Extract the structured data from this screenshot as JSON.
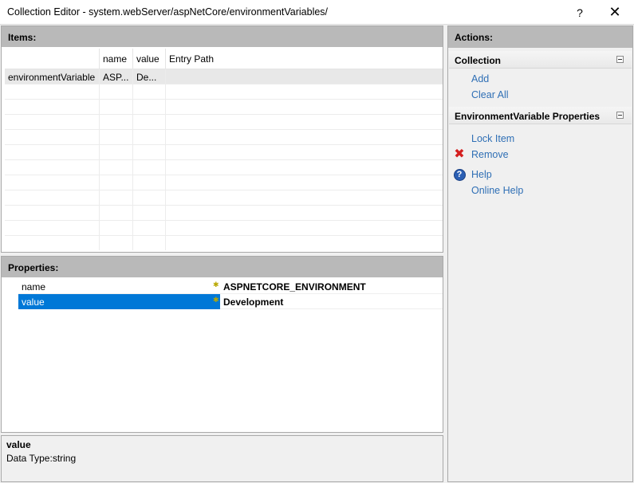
{
  "window": {
    "title": "Collection Editor - system.webServer/aspNetCore/environmentVariables/",
    "help_glyph": "?",
    "close_glyph": "✕"
  },
  "items": {
    "header": "Items:",
    "columns": [
      "",
      "name",
      "value",
      "Entry Path"
    ],
    "rows": [
      [
        "environmentVariable",
        "ASP...",
        "De...",
        ""
      ]
    ]
  },
  "properties": {
    "header": "Properties:",
    "rows": [
      {
        "name": "name",
        "value": "ASPNETCORE_ENVIRONMENT",
        "marker": "✱"
      },
      {
        "name": "value",
        "value": "Development",
        "marker": "✱"
      }
    ]
  },
  "description": {
    "title": "value",
    "text": "Data Type:string"
  },
  "actions": {
    "header": "Actions:",
    "collection": {
      "label": "Collection",
      "links": [
        "Add",
        "Clear All"
      ]
    },
    "item_properties": {
      "label": "EnvironmentVariable Properties",
      "links": [
        {
          "label": "Lock Item",
          "icon": ""
        },
        {
          "label": "Remove",
          "icon": "remove-icon"
        },
        {
          "label": "Help",
          "icon": "help-icon"
        },
        {
          "label": "Online Help",
          "icon": ""
        }
      ]
    }
  },
  "colors": {
    "selection": "#0078d7",
    "link": "#2f6fb5",
    "header_bg": "#b9b9b9"
  }
}
